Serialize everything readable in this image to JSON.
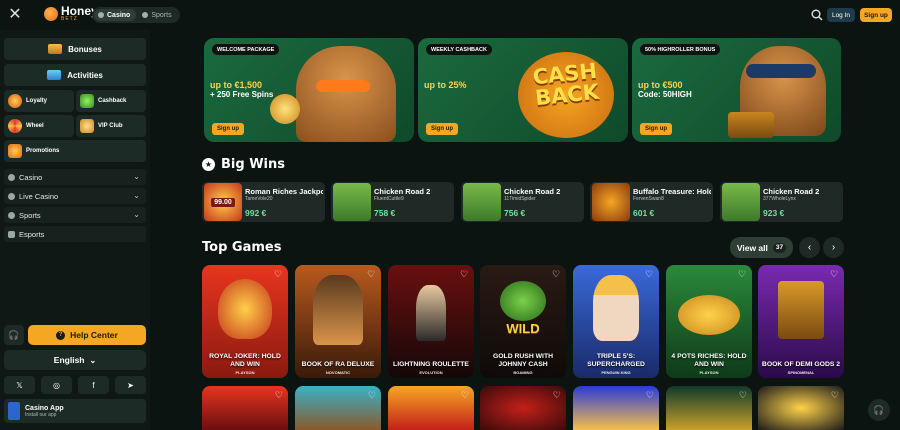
{
  "header": {
    "logo_name": "Honey",
    "logo_sub": "BETZ",
    "tabs": [
      {
        "label": "Casino",
        "active": true
      },
      {
        "label": "Sports",
        "active": false
      }
    ],
    "login_label": "Log In",
    "signup_label": "Sign up"
  },
  "sidebar": {
    "bonuses_label": "Bonuses",
    "activities_label": "Activities",
    "tiles": [
      "Loyalty",
      "Cashback",
      "Wheel",
      "VIP Club",
      "Promotions"
    ],
    "rows": [
      "Casino",
      "Live Casino",
      "Sports",
      "Esports"
    ],
    "help_label": "Help Center",
    "language": "English",
    "app_title": "Casino App",
    "app_subtitle": "Install our app"
  },
  "promos": [
    {
      "tag": "WELCOME PACKAGE",
      "line1": "up to €1,500",
      "line2": "+ 250 Free Spins",
      "cta": "Sign up"
    },
    {
      "tag": "WEEKLY CASHBACK",
      "line1": "up to 25%",
      "line2": "",
      "art_text1": "CASH",
      "art_text2": "BACK",
      "cta": "Sign up"
    },
    {
      "tag": "50% HIGHROLLER BONUS",
      "line1": "up to €500",
      "line2": "Code: 50HIGH",
      "cta": "Sign up"
    }
  ],
  "big_wins": {
    "title": "Big Wins",
    "items": [
      {
        "game": "Roman Riches Jackpot",
        "user": "TameVole20",
        "amount": "992 €",
        "thumb_label": "99.00"
      },
      {
        "game": "Chicken Road 2",
        "user": "FluentCuttle9",
        "amount": "758 €"
      },
      {
        "game": "Chicken Road 2",
        "user": "11TimidSpider",
        "amount": "756 €"
      },
      {
        "game": "Buffalo Treasure: Hold",
        "user": "FervenSwan8",
        "amount": "601 €"
      },
      {
        "game": "Chicken Road 2",
        "user": "377WholeLynx",
        "amount": "923 €"
      }
    ]
  },
  "top_games": {
    "title": "Top Games",
    "view_all_label": "View all",
    "count": "37",
    "items": [
      {
        "title": "ROYAL JOKER: HOLD AND WIN",
        "provider": "PLAYSON"
      },
      {
        "title": "BOOK OF RA DELUXE",
        "provider": "NOVOMATIC"
      },
      {
        "title": "LIGHTNING ROULETTE",
        "provider": "EVOLUTION"
      },
      {
        "title": "GOLD RUSH WITH JOHNNY CASH",
        "provider": "BGAMING",
        "art_text": "WILD"
      },
      {
        "title": "TRIPLE 5'S: SUPERCHARGED",
        "provider": "PENGUIN KING"
      },
      {
        "title": "4 POTS RICHES: HOLD AND WIN",
        "provider": "PLAYSON"
      },
      {
        "title": "BOOK OF DEMI GODS 2",
        "provider": "SPINOMENAL"
      }
    ]
  }
}
